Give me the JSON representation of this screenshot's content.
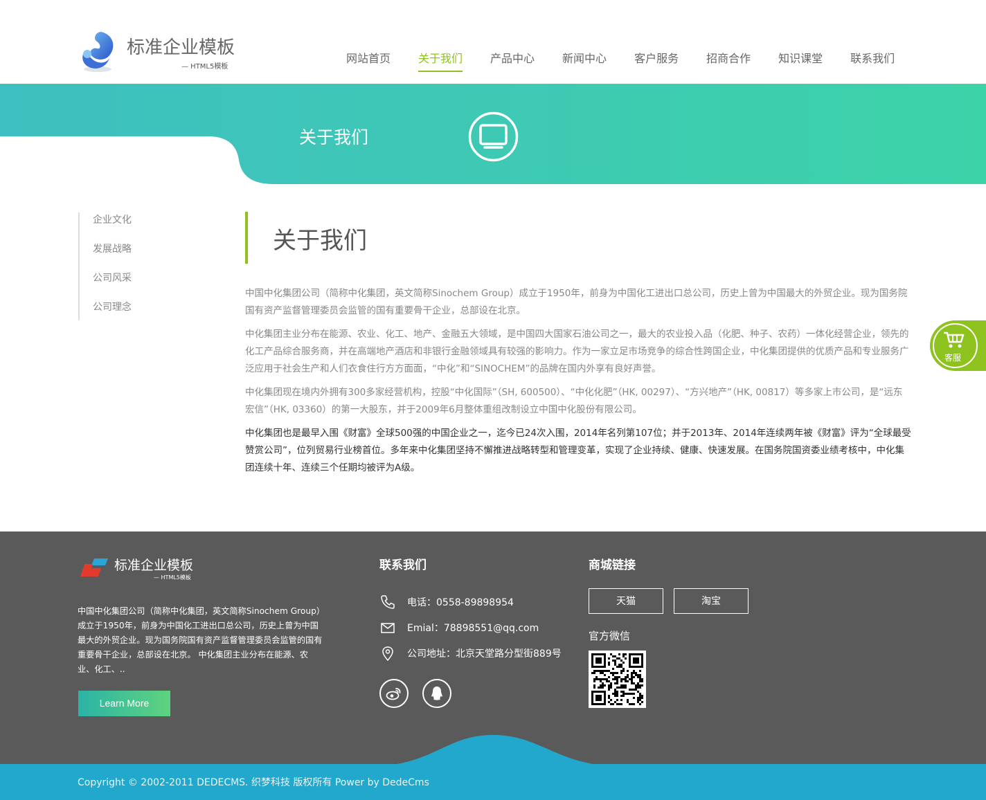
{
  "header": {
    "site_title": "标准企业模板",
    "site_subtitle": "— HTML5模板",
    "nav": [
      {
        "label": "网站首页",
        "active": false
      },
      {
        "label": "关于我们",
        "active": true
      },
      {
        "label": "产品中心",
        "active": false
      },
      {
        "label": "新闻中心",
        "active": false
      },
      {
        "label": "客户服务",
        "active": false
      },
      {
        "label": "招商合作",
        "active": false
      },
      {
        "label": "知识课堂",
        "active": false
      },
      {
        "label": "联系我们",
        "active": false
      }
    ]
  },
  "banner": {
    "title": "关于我们",
    "icon": "monitor-icon"
  },
  "sidebar": {
    "items": [
      {
        "label": "企业文化"
      },
      {
        "label": "发展战略"
      },
      {
        "label": "公司风采"
      },
      {
        "label": "公司理念"
      }
    ]
  },
  "content": {
    "title": "关于我们",
    "paragraphs": [
      "中国中化集团公司（简称中化集团，英文简称Sinochem Group）成立于1950年，前身为中国化工进出口总公司，历史上曾为中国最大的外贸企业。现为国务院国有资产监督管理委员会监管的国有重要骨干企业，总部设在北京。",
      "中化集团主业分布在能源、农业、化工、地产、金融五大领域，是中国四大国家石油公司之一，最大的农业投入品（化肥、种子、农药）一体化经营企业，领先的化工产品综合服务商，并在高端地产酒店和非银行金融领域具有较强的影响力。作为一家立足市场竞争的综合性跨国企业，中化集团提供的优质产品和专业服务广泛应用于社会生产和人们衣食住行方方面面，“中化”和“SINOCHEM”的品牌在国内外享有良好声誉。",
      "中化集团现在境内外拥有300多家经营机构，控股“中化国际”（SH, 600500）、“中化化肥”（HK, 00297）、“方兴地产”（HK, 00817）等多家上市公司，是“远东宏信”（HK, 03360）的第一大股东，并于2009年6月整体重组改制设立中国中化股份有限公司。",
      "中化集团也是最早入围《财富》全球500强的中国企业之一，迄今已24次入围，2014年名列第107位；并于2013年、2014年连续两年被《财富》评为“全球最受赞赏公司”，位列贸易行业榜首位。多年来中化集团坚持不懈推进战略转型和管理变革，实现了企业持续、健康、快速发展。在国务院国资委业绩考核中，中化集团连续十年、连续三个任期均被评为A级。"
    ]
  },
  "kefu": {
    "label": "客服",
    "icon": "cart-icon"
  },
  "footer": {
    "title": "标准企业模板",
    "subtitle": "— HTML5模板",
    "intro": "中国中化集团公司（简称中化集团，英文简称Sinochem Group）成立于1950年，前身为中国化工进出口总公司，历史上曾为中国最大的外贸企业。现为国务院国有资产监督管理委员会监管的国有重要骨干企业，总部设在北京。 中化集团主业分布在能源、农业、化工、..",
    "learn_more": "Learn More",
    "contact_heading": "联系我们",
    "phone": "电话：0558-89898954",
    "email": "Emial：78898551@qq.com",
    "address": "公司地址：北京天堂路分型街889号",
    "social": [
      "weibo-icon",
      "qq-icon"
    ],
    "shop_heading": "商城链接",
    "shop_links": [
      "天猫",
      "淘宝"
    ],
    "wechat_label": "官方微信",
    "copyright": "Copyright © 2002-2011 DEDECMS. 织梦科技 版权所有 Power by DedeCms"
  },
  "colors": {
    "accent_green": "#8dc21f",
    "banner_teal": "#3fc4c0",
    "footer_gray": "#5a5a5a",
    "footer_blue": "#22a8cd"
  }
}
